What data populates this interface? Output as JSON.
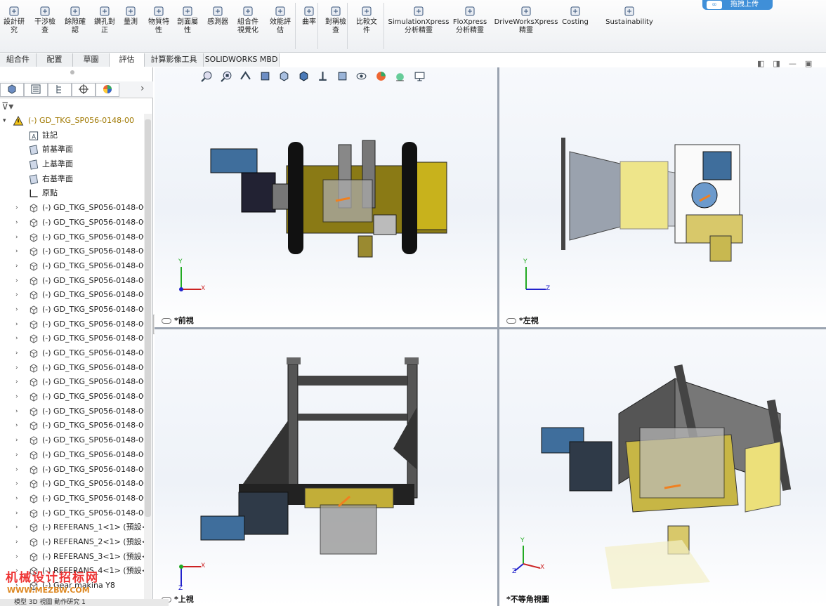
{
  "ribbon": {
    "items": [
      {
        "label": "設計研\n究",
        "icon": "design-study-icon"
      },
      {
        "label": "干涉檢\n查",
        "icon": "interference-icon"
      },
      {
        "label": "餘隙確\n認",
        "icon": "clearance-icon"
      },
      {
        "label": "鑽孔對\n正",
        "icon": "hole-align-icon"
      },
      {
        "label": "量測",
        "icon": "measure-icon"
      },
      {
        "label": "物質特\n性",
        "icon": "mass-props-icon"
      },
      {
        "label": "剖面屬\n性",
        "icon": "section-props-icon"
      },
      {
        "label": "感測器",
        "icon": "sensor-icon"
      },
      {
        "label": "組合件\n視覺化",
        "icon": "assembly-vis-icon"
      },
      {
        "label": "效能評\n估",
        "icon": "performance-icon"
      },
      {
        "label": "曲率",
        "icon": "curvature-icon"
      },
      {
        "label": "對稱檢\n查",
        "icon": "symmetry-icon"
      },
      {
        "label": "比較文\n件",
        "icon": "compare-icon"
      },
      {
        "label": "SimulationXpress\n分析精靈",
        "icon": "simxpress-icon"
      },
      {
        "label": "FloXpress\n分析精靈",
        "icon": "floxpress-icon"
      },
      {
        "label": "DriveWorksXpress\n精靈",
        "icon": "driveworks-icon"
      },
      {
        "label": "Costing",
        "icon": "costing-icon"
      },
      {
        "label": "Sustainability",
        "icon": "sustainability-icon"
      }
    ],
    "upload_label": "拖拽上传"
  },
  "tabs": [
    {
      "label": "組合件"
    },
    {
      "label": "配置"
    },
    {
      "label": "草圖"
    },
    {
      "label": "評估",
      "active": true
    },
    {
      "label": "計算影像工具"
    },
    {
      "label": "SOLIDWORKS MBD"
    }
  ],
  "tree": {
    "root": "(-) GD_TKG_SP056-0148-00",
    "fixed": [
      {
        "label": "註記",
        "icon": "annotation-icon"
      },
      {
        "label": "前基準面",
        "icon": "plane-icon"
      },
      {
        "label": "上基準面",
        "icon": "plane-icon"
      },
      {
        "label": "右基準面",
        "icon": "plane-icon"
      },
      {
        "label": "原點",
        "icon": "origin-icon"
      }
    ],
    "parts": [
      "(-) GD_TKG_SP056-0148-00",
      "(-) GD_TKG_SP056-0148-00",
      "(-) GD_TKG_SP056-0148-00",
      "(-) GD_TKG_SP056-0148-00",
      "(-) GD_TKG_SP056-0148-00",
      "(-) GD_TKG_SP056-0148-00",
      "(-) GD_TKG_SP056-0148-00",
      "(-) GD_TKG_SP056-0148-00",
      "(-) GD_TKG_SP056-0148-00",
      "(-) GD_TKG_SP056-0148-00",
      "(-) GD_TKG_SP056-0148-00",
      "(-) GD_TKG_SP056-0148-00",
      "(-) GD_TKG_SP056-0148-00",
      "(-) GD_TKG_SP056-0148-00",
      "(-) GD_TKG_SP056-0148-00",
      "(-) GD_TKG_SP056-0148-00",
      "(-) GD_TKG_SP056-0148-00",
      "(-) GD_TKG_SP056-0148-00",
      "(-) GD_TKG_SP056-0148-00",
      "(-) GD_TKG_SP056-0148-00",
      "(-) GD_TKG_SP056-0148-00",
      "(-) GD_TKG_SP056-0148-00",
      "(-) REFERANS_1<1> (預設<",
      "(-) REFERANS_2<1> (預設<",
      "(-) REFERANS_3<1> (預設<",
      "(-) REFERANS_4<1> (預設<",
      "(-) Gear makina Y8"
    ]
  },
  "viewports": {
    "front": "*前視",
    "left": "*左視",
    "top": "*上視",
    "iso": "*不等角視圖"
  },
  "axes": {
    "x": "X",
    "y": "Y",
    "z": "Z"
  },
  "watermark": {
    "title": "机械设计招标网",
    "url": "WWW.MEZBW.COM"
  },
  "bottom_tabs": "模型  3D 視圖  動作研究 1"
}
